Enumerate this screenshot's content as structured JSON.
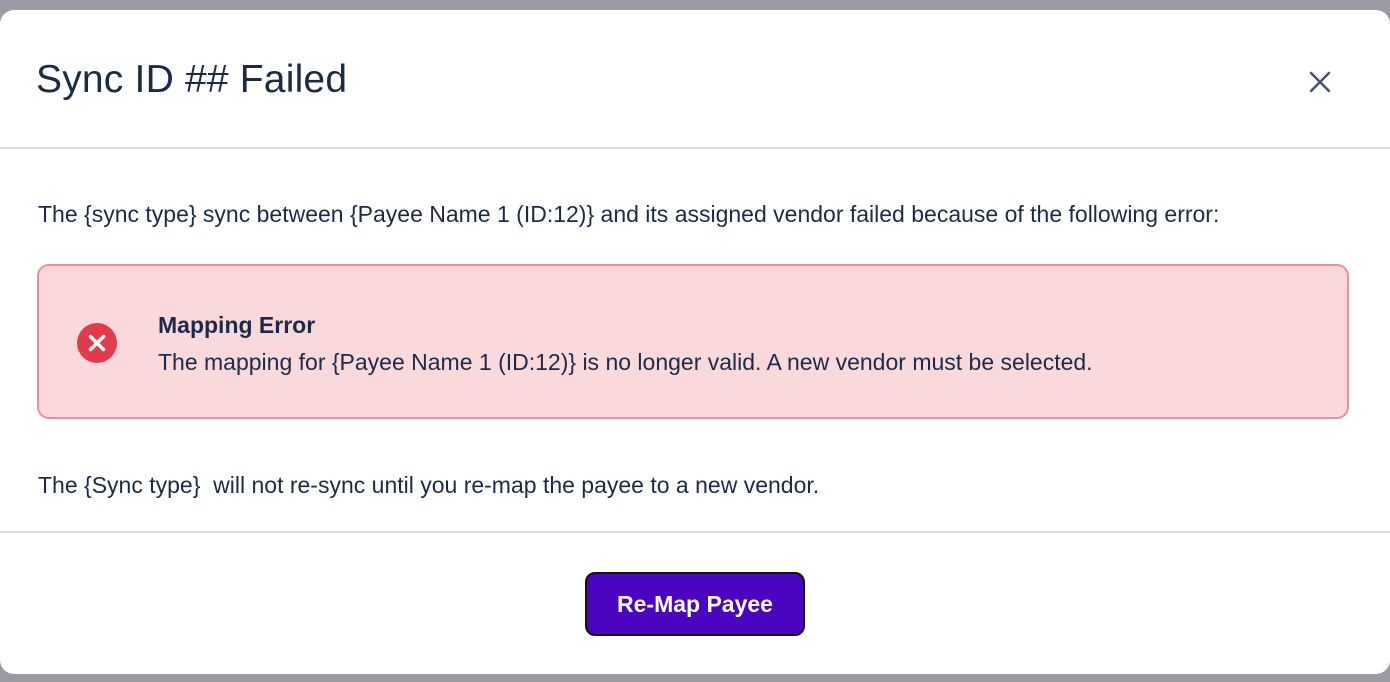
{
  "modal": {
    "title": "Sync ID ## Failed",
    "close_icon": "close-icon"
  },
  "body": {
    "intro": "The {sync type} sync between {Payee Name 1 (ID:12)} and its assigned vendor failed because of the following error:",
    "alert": {
      "icon": "error-circle-x-icon",
      "title": "Mapping Error",
      "message": "The mapping for {Payee Name 1 (ID:12)} is no longer valid. A new vendor must be selected."
    },
    "note": "The {Sync type}  will not re-sync until you re-map the payee to a new vendor."
  },
  "footer": {
    "primary_button": "Re-Map Payee"
  },
  "colors": {
    "accent": "#4b04bf",
    "error": "#e23b4c",
    "alert_bg": "#fad9dc",
    "alert_border": "#ee8e96",
    "text": "#1c2a4a"
  }
}
